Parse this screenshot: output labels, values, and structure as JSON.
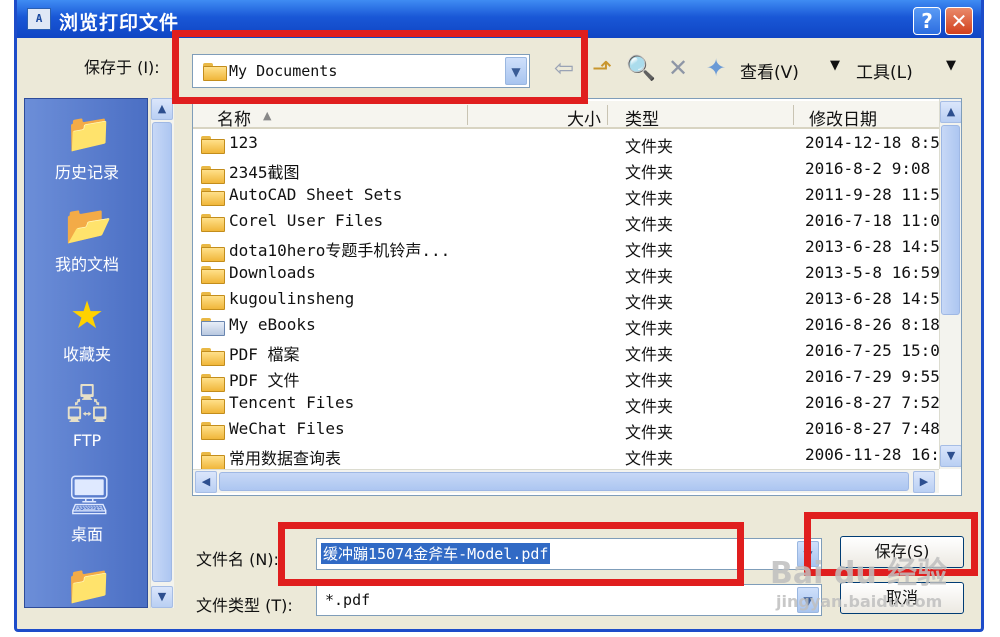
{
  "window": {
    "title": "浏览打印文件",
    "app_icon": "A",
    "help_label": "?",
    "close_label": "✕"
  },
  "toolbar": {
    "save_in_label": "保存于 (I):",
    "location": "My Documents",
    "view_label": "查看(V)",
    "tools_label": "工具(L)",
    "icons": [
      "back-icon",
      "up-folder-icon",
      "search-web-icon",
      "delete-icon",
      "new-folder-icon"
    ]
  },
  "places": [
    {
      "label": "历史记录",
      "icon": "history-icon"
    },
    {
      "label": "我的文档",
      "icon": "my-documents-icon"
    },
    {
      "label": "收藏夹",
      "icon": "favorites-icon"
    },
    {
      "label": "FTP",
      "icon": "ftp-icon"
    },
    {
      "label": "桌面",
      "icon": "desktop-icon"
    }
  ],
  "columns": {
    "name": "名称",
    "size": "大小",
    "type": "类型",
    "modified": "修改日期"
  },
  "files": [
    {
      "name": "123",
      "type": "文件夹",
      "modified": "2014-12-18 8:5"
    },
    {
      "name": "2345截图",
      "type": "文件夹",
      "modified": "2016-8-2 9:08"
    },
    {
      "name": "AutoCAD Sheet Sets",
      "type": "文件夹",
      "modified": "2011-9-28 11:5"
    },
    {
      "name": "Corel User Files",
      "type": "文件夹",
      "modified": "2016-7-18 11:0"
    },
    {
      "name": "dota10hero专题手机铃声...",
      "type": "文件夹",
      "modified": "2013-6-28 14:5"
    },
    {
      "name": "Downloads",
      "type": "文件夹",
      "modified": "2013-5-8 16:59"
    },
    {
      "name": "kugoulinsheng",
      "type": "文件夹",
      "modified": "2013-6-28 14:5"
    },
    {
      "name": "My eBooks",
      "type": "文件夹",
      "modified": "2016-8-26 8:18"
    },
    {
      "name": "PDF 檔案",
      "type": "文件夹",
      "modified": "2016-7-25 15:0"
    },
    {
      "name": "PDF 文件",
      "type": "文件夹",
      "modified": "2016-7-29 9:55"
    },
    {
      "name": "Tencent Files",
      "type": "文件夹",
      "modified": "2016-8-27 7:52"
    },
    {
      "name": "WeChat Files",
      "type": "文件夹",
      "modified": "2016-8-27 7:48"
    },
    {
      "name": "常用数据查询表",
      "type": "文件夹",
      "modified": "2006-11-28 16:2"
    }
  ],
  "filename": {
    "label": "文件名 (N):",
    "value": "缓冲蹦15074金斧车-Model.pdf"
  },
  "filetype": {
    "label": "文件类型 (T):",
    "value": "*.pdf"
  },
  "buttons": {
    "save": "保存(S)",
    "cancel": "取消"
  },
  "watermark": {
    "brand": "Bai du 经验",
    "url": "jingyan.baidu.com"
  }
}
